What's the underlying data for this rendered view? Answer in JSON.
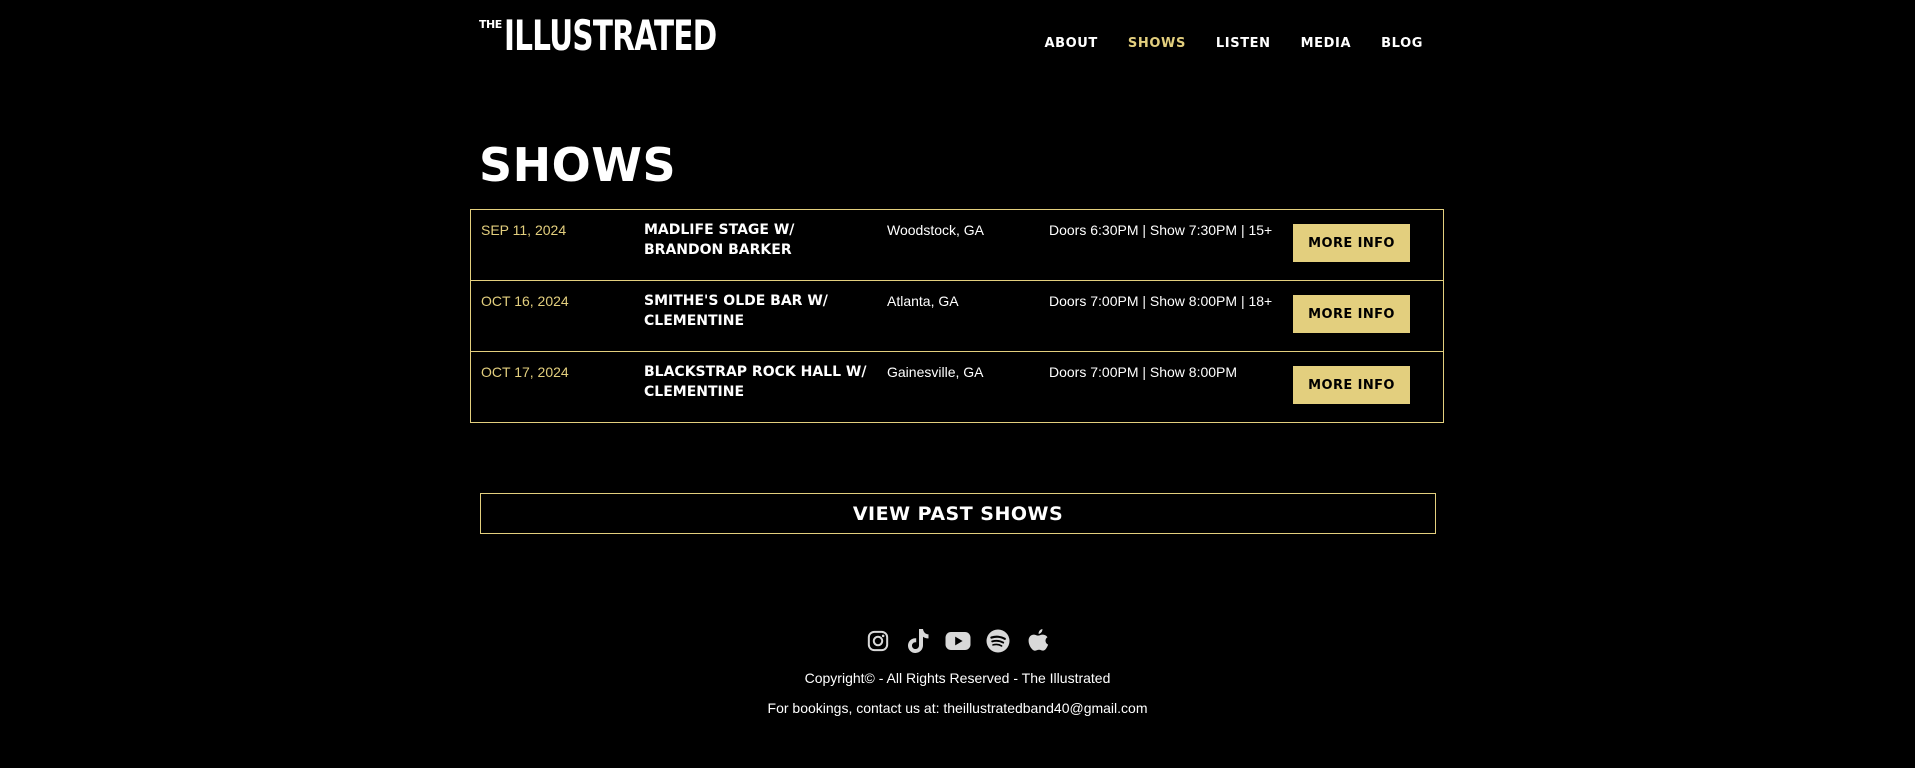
{
  "header": {
    "logo_small": "THE",
    "logo_main": "ILLUSTRATED",
    "nav": [
      {
        "label": "ABOUT"
      },
      {
        "label": "SHOWS"
      },
      {
        "label": "LISTEN"
      },
      {
        "label": "MEDIA"
      },
      {
        "label": "BLOG"
      }
    ],
    "active_nav": "SHOWS"
  },
  "main": {
    "title": "SHOWS",
    "shows": [
      {
        "date": "SEP 11, 2024",
        "venue": "MADLIFE STAGE W/ BRANDON BARKER",
        "location": "Woodstock, GA",
        "times": "Doors 6:30PM | Show 7:30PM | 15+",
        "button": "MORE INFO"
      },
      {
        "date": "OCT 16, 2024",
        "venue": "SMITHE'S OLDE BAR W/ CLEMENTINE",
        "location": "Atlanta, GA",
        "times": "Doors 7:00PM | Show 8:00PM | 18+",
        "button": "MORE INFO"
      },
      {
        "date": "OCT 17, 2024",
        "venue": "BLACKSTRAP ROCK HALL W/ CLEMENTINE",
        "location": "Gainesville, GA",
        "times": "Doors 7:00PM | Show 8:00PM",
        "button": "MORE INFO"
      }
    ],
    "past_shows_label": "VIEW PAST SHOWS"
  },
  "footer": {
    "socials": [
      {
        "icon": "instagram-icon"
      },
      {
        "icon": "tiktok-icon"
      },
      {
        "icon": "youtube-icon"
      },
      {
        "icon": "spotify-icon"
      },
      {
        "icon": "apple-icon"
      }
    ],
    "copyright": "Copyright© - All Rights Reserved - The Illustrated",
    "bookings": "For bookings, contact us at: theillustratedband40@gmail.com"
  },
  "colors": {
    "background": "#000000",
    "accent": "#e3cf7e",
    "text": "#ffffff",
    "icon": "#d9d9d9"
  }
}
